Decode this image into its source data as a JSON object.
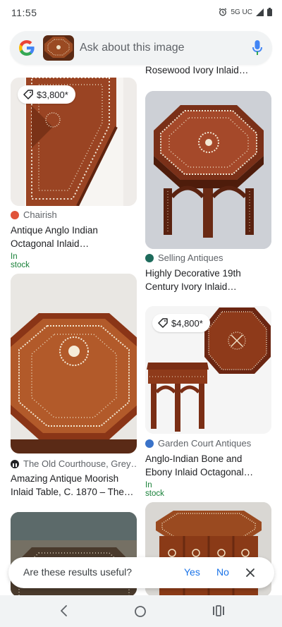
{
  "status": {
    "time": "11:55",
    "network": "5G UC"
  },
  "search": {
    "placeholder": "Ask about this image"
  },
  "results": [
    {
      "price": "$3,800*",
      "source": "Chairish",
      "title": "Antique Anglo Indian Octagonal Inlaid…",
      "stock": "In stock"
    },
    {
      "title": "Rosewood Ivory Inlaid…"
    },
    {
      "source": "Selling Antiques",
      "title": "Highly Decorative 19th Century Ivory Inlaid…"
    },
    {
      "source": "The Old Courthouse, Grey…",
      "title": "Amazing Antique Moorish Inlaid Table, C. 1870 – The…"
    },
    {
      "price": "$4,800*",
      "source": "Garden Court Antiques",
      "title": "Anglo-Indian Bone and Ebony Inlaid Octagonal…",
      "stock": "In stock"
    }
  ],
  "feedback": {
    "question": "Are these results useful?",
    "yes": "Yes",
    "no": "No"
  },
  "colors": {
    "accent": "#1a73e8",
    "stock": "#188038",
    "wood": "#8b3a1e"
  }
}
